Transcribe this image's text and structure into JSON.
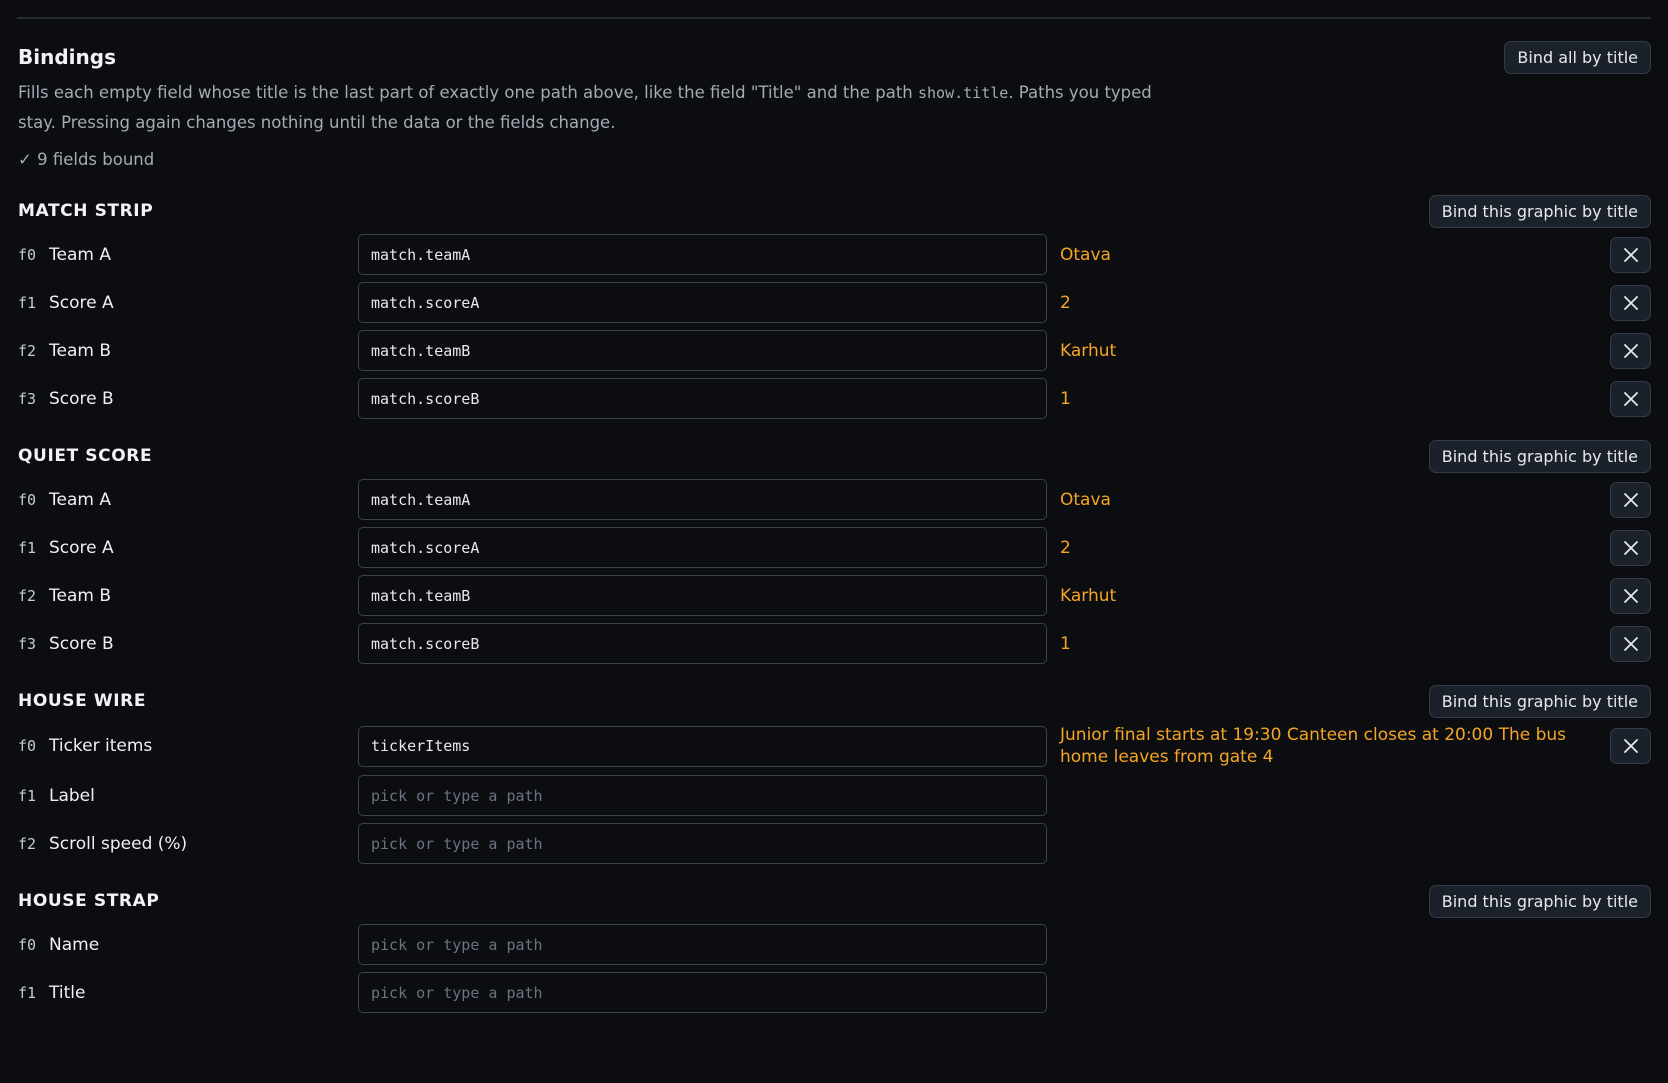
{
  "bindings": {
    "title": "Bindings",
    "bind_all_label": "Bind all by title",
    "desc_before": "Fills each empty field whose title is the last part of exactly one path above, like the field \"Title\" and the path ",
    "desc_code": "show.title",
    "desc_after": ". Paths you typed stay. Pressing again changes nothing until the data or the fields change.",
    "status": "✓ 9 fields bound"
  },
  "bind_graphic_label": "Bind this graphic by title",
  "path_placeholder": "pick or type a path",
  "icons": {
    "clear": "close-icon"
  },
  "colors": {
    "value": "#f5a524",
    "background": "#0b0d10"
  },
  "sections": [
    {
      "title": "MATCH STRIP",
      "fields": [
        {
          "id": "f0",
          "label": "Team A",
          "path": "match.teamA",
          "value": "Otava"
        },
        {
          "id": "f1",
          "label": "Score A",
          "path": "match.scoreA",
          "value": "2"
        },
        {
          "id": "f2",
          "label": "Team B",
          "path": "match.teamB",
          "value": "Karhut"
        },
        {
          "id": "f3",
          "label": "Score B",
          "path": "match.scoreB",
          "value": "1"
        }
      ]
    },
    {
      "title": "QUIET SCORE",
      "fields": [
        {
          "id": "f0",
          "label": "Team A",
          "path": "match.teamA",
          "value": "Otava"
        },
        {
          "id": "f1",
          "label": "Score A",
          "path": "match.scoreA",
          "value": "2"
        },
        {
          "id": "f2",
          "label": "Team B",
          "path": "match.teamB",
          "value": "Karhut"
        },
        {
          "id": "f3",
          "label": "Score B",
          "path": "match.scoreB",
          "value": "1"
        }
      ]
    },
    {
      "title": "HOUSE WIRE",
      "fields": [
        {
          "id": "f0",
          "label": "Ticker items",
          "path": "tickerItems",
          "value": "Junior final starts at 19:30 Canteen closes at 20:00 The bus home leaves from gate 4"
        },
        {
          "id": "f1",
          "label": "Label",
          "path": "",
          "value": ""
        },
        {
          "id": "f2",
          "label": "Scroll speed (%)",
          "path": "",
          "value": ""
        }
      ]
    },
    {
      "title": "HOUSE STRAP",
      "fields": [
        {
          "id": "f0",
          "label": "Name",
          "path": "",
          "value": ""
        },
        {
          "id": "f1",
          "label": "Title",
          "path": "",
          "value": ""
        }
      ]
    }
  ]
}
